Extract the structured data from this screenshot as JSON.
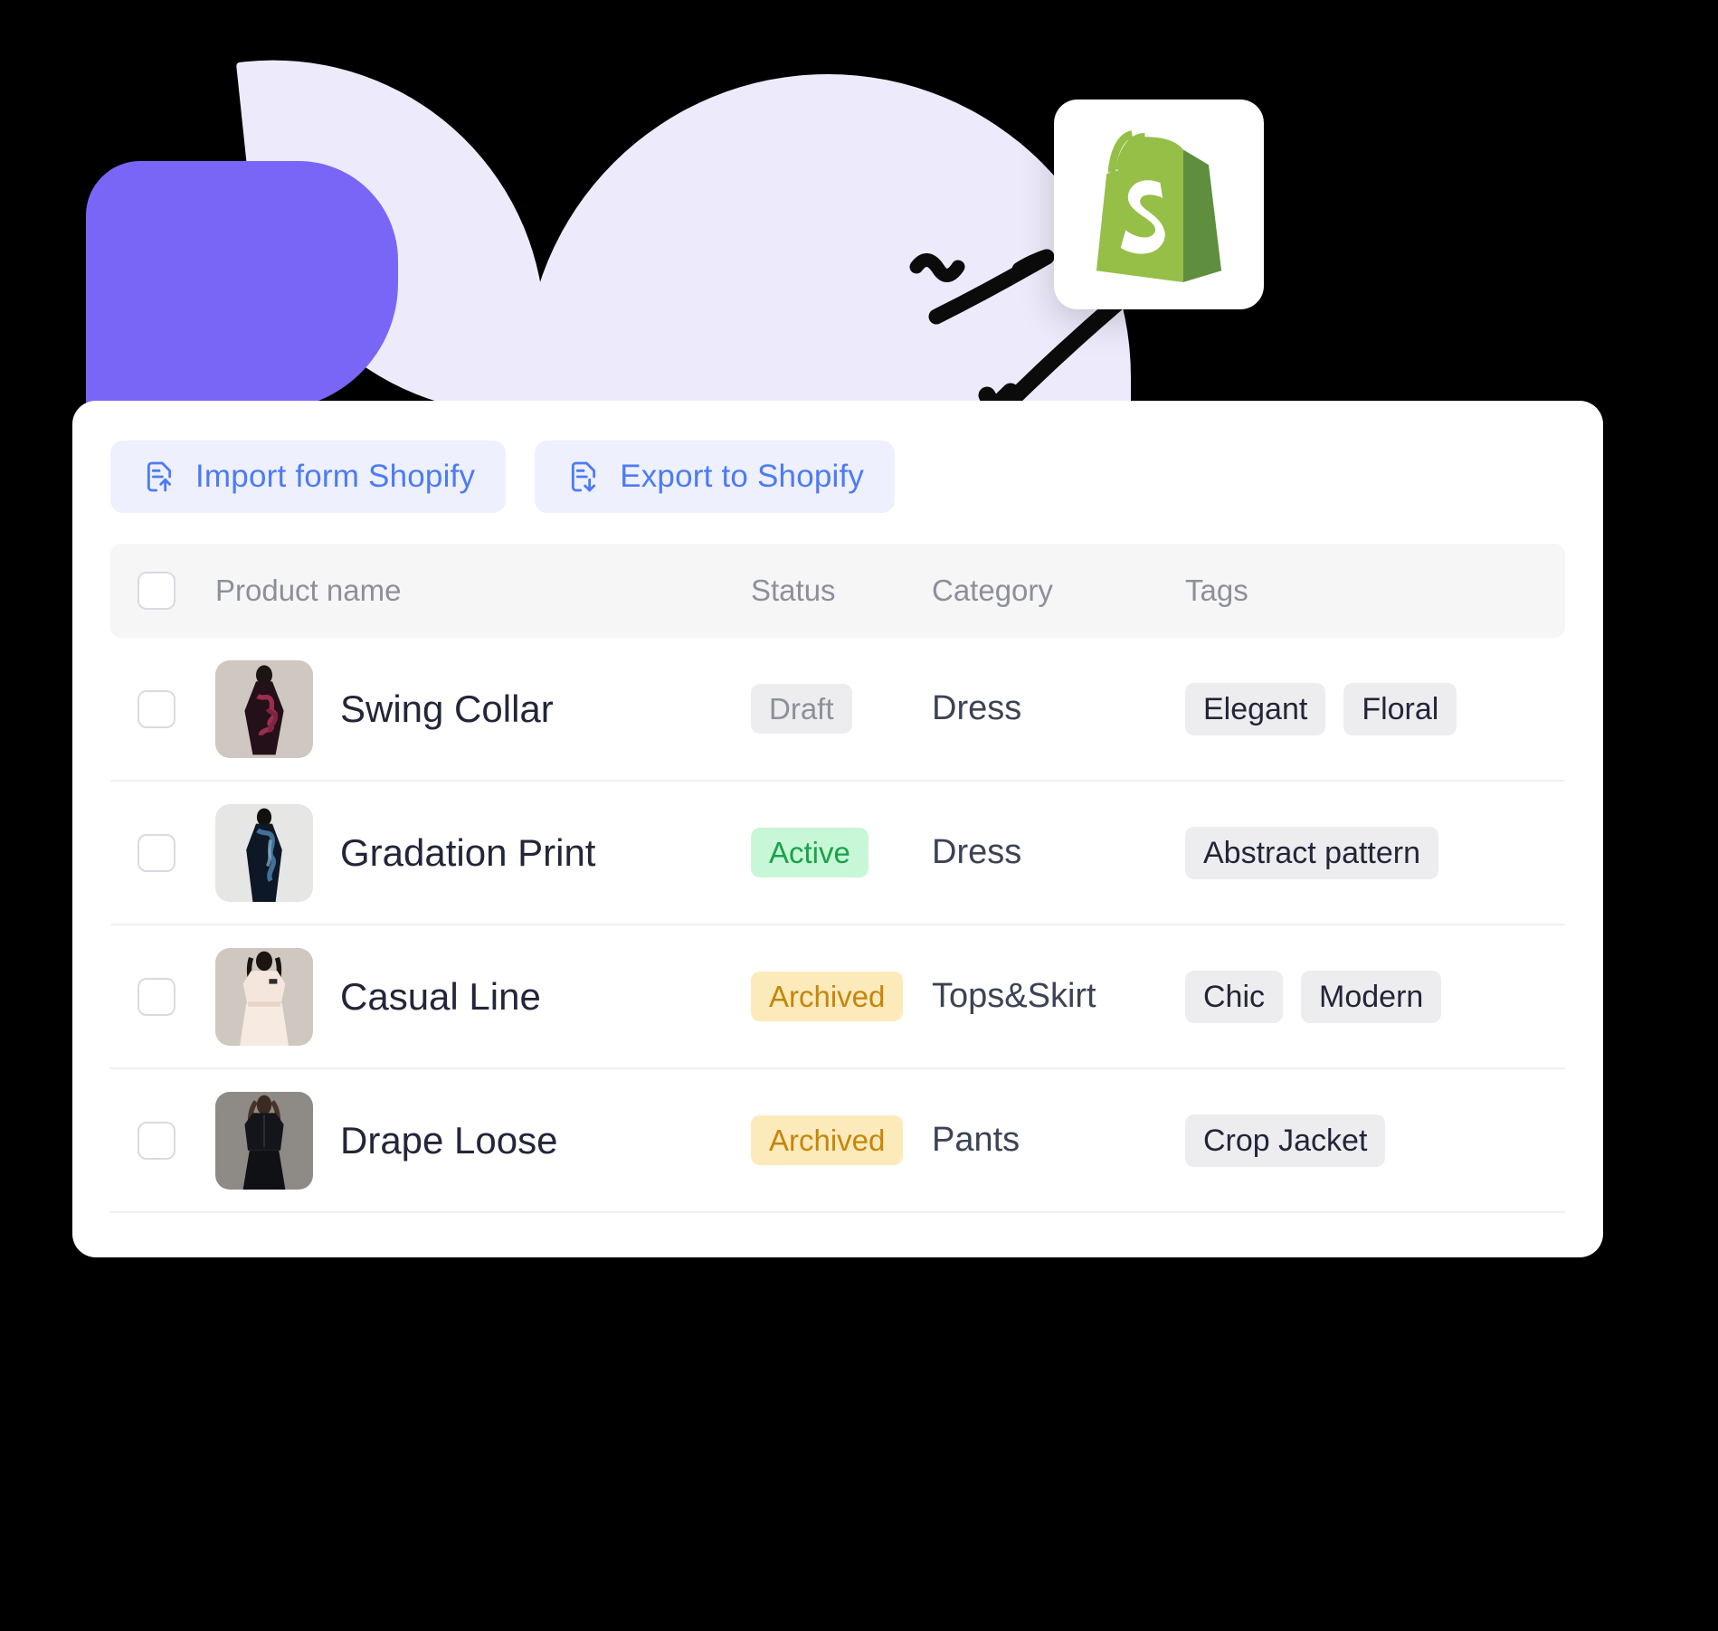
{
  "logo": {
    "name": "shopify-logo",
    "alt": "Shopify"
  },
  "toolbar": {
    "import_label": "Import form Shopify",
    "import_icon": "file-upload-icon",
    "export_label": "Export to Shopify",
    "export_icon": "file-download-icon"
  },
  "table": {
    "columns": [
      "Product name",
      "Status",
      "Category",
      "Tags"
    ],
    "select_all_checked": false,
    "rows": [
      {
        "checked": false,
        "name": "Swing Collar",
        "status": "Draft",
        "status_kind": "draft",
        "category": "Dress",
        "tags": [
          "Elegant",
          "Floral"
        ],
        "thumb": "dark-floral-gown"
      },
      {
        "checked": false,
        "name": "Gradation Print",
        "status": "Active",
        "status_kind": "active",
        "category": "Dress",
        "tags": [
          "Abstract pattern"
        ],
        "thumb": "blue-black-gradient-gown"
      },
      {
        "checked": false,
        "name": "Casual Line",
        "status": "Archived",
        "status_kind": "archived",
        "category": "Tops&Skirt",
        "tags": [
          "Chic",
          "Modern"
        ],
        "thumb": "cream-casual-set"
      },
      {
        "checked": false,
        "name": "Drape Loose",
        "status": "Archived",
        "status_kind": "archived",
        "category": "Pants",
        "tags": [
          "Crop Jacket"
        ],
        "thumb": "black-crop-jacket-pants"
      }
    ]
  },
  "colors": {
    "accent_purple": "#7A66F6",
    "lavender": "#EDEBFB",
    "button_bg": "#EEF0FE",
    "button_text": "#4C7BF4",
    "shopify_green": "#95BF47",
    "shopify_green_dark": "#5E8E3E",
    "status_draft_bg": "#EDEDEF",
    "status_draft_text": "#8C909A",
    "status_active_bg": "#C8F7D7",
    "status_active_text": "#18A349",
    "status_archived_bg": "#FDEABB",
    "status_archived_text": "#C4860C"
  }
}
